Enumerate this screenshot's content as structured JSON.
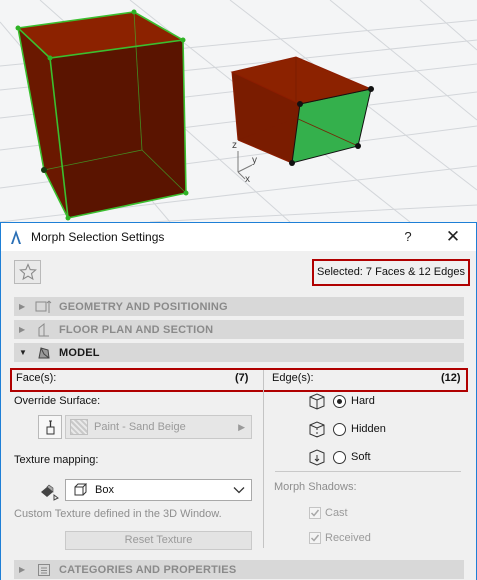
{
  "dialog": {
    "title": "Morph Selection Settings",
    "help_label": "?",
    "close_label": "✕",
    "selection_info": "Selected: 7 Faces & 12 Edges"
  },
  "sections": {
    "geometry": "GEOMETRY AND POSITIONING",
    "floorplan": "FLOOR PLAN AND SECTION",
    "model": "MODEL",
    "categories": "CATEGORIES AND PROPERTIES"
  },
  "faces": {
    "header": "Face(s):",
    "count": "(7)",
    "override_label": "Override Surface:",
    "surface_value": "Paint - Sand Beige",
    "texture_label": "Texture mapping:",
    "texture_value": "Box",
    "texture_note": "Custom Texture defined in the 3D Window.",
    "reset_label": "Reset Texture"
  },
  "edges": {
    "header": "Edge(s):",
    "count": "(12)",
    "options": [
      "Hard",
      "Hidden",
      "Soft"
    ],
    "selected": "Hard",
    "shadows_label": "Morph Shadows:",
    "cast_label": "Cast",
    "received_label": "Received"
  },
  "axes": {
    "z": "z",
    "y": "y",
    "x": "x"
  },
  "colors": {
    "morph_face": "#7a1a00",
    "selected_face": "#2ea84a",
    "selection_edge": "#3bbf2f",
    "highlight_box": "#b00000",
    "dialog_border": "#1e7fd6"
  },
  "icons": {
    "favorite": "star-icon",
    "geometry": "geometry-icon",
    "floorplan": "floor-plan-icon",
    "model": "model-icon",
    "categories": "list-icon",
    "brush": "paint-brush-icon",
    "texture": "texture-mapping-icon",
    "box": "box-icon"
  }
}
